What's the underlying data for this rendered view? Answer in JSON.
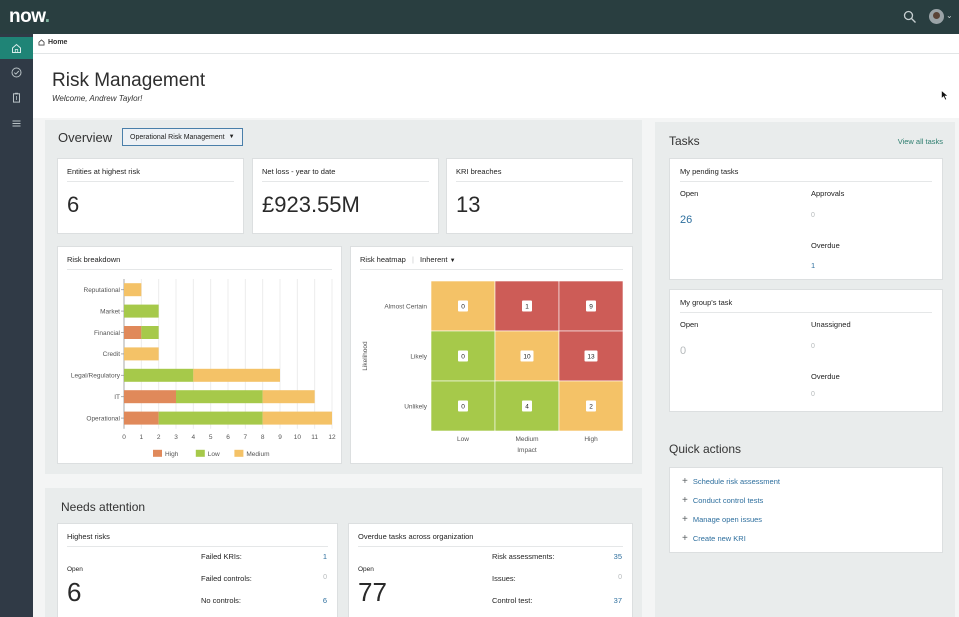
{
  "app": {
    "logo": "now",
    "logo_dot": "."
  },
  "breadcrumb": {
    "label": "Home"
  },
  "header": {
    "title": "Risk Management",
    "welcome": "Welcome, Andrew Taylor!"
  },
  "overview": {
    "title": "Overview",
    "selector": "Operational Risk Management",
    "metrics": [
      {
        "label": "Entities at highest risk",
        "value": "6"
      },
      {
        "label": "Net loss - year to date",
        "value": "£923.55M"
      },
      {
        "label": "KRI breaches",
        "value": "13"
      }
    ],
    "risk_breakdown_title": "Risk breakdown",
    "heatmap_title": "Risk heatmap",
    "heatmap_mode": "Inherent"
  },
  "chart_data": [
    {
      "type": "bar",
      "orientation": "horizontal",
      "stacked": true,
      "title": "Risk breakdown",
      "categories": [
        "Reputational",
        "Market",
        "Financial",
        "Credit",
        "Legal/Regulatory",
        "IT",
        "Operational"
      ],
      "series": [
        {
          "name": "High",
          "color": "#e0895a",
          "values": [
            0,
            0,
            1,
            0,
            0,
            3,
            2
          ]
        },
        {
          "name": "Low",
          "color": "#a6c94a",
          "values": [
            0,
            2,
            1,
            0,
            4,
            5,
            6
          ]
        },
        {
          "name": "Medium",
          "color": "#f4c267",
          "values": [
            1,
            0,
            0,
            2,
            5,
            3,
            4
          ]
        }
      ],
      "x_ticks": [
        "0",
        "1",
        "2",
        "3",
        "4",
        "5",
        "6",
        "7",
        "8",
        "9",
        "10",
        "11",
        "12"
      ],
      "xlim": [
        0,
        12
      ],
      "grid": true,
      "legend": "bottom"
    },
    {
      "type": "heatmap",
      "title": "Risk heatmap",
      "ylabel": "Likelihood",
      "xlabel": "Impact",
      "rows": [
        "Almost Certain",
        "Likely",
        "Unlikely"
      ],
      "cols": [
        "Low",
        "Medium",
        "High"
      ],
      "values": [
        [
          0,
          1,
          9
        ],
        [
          0,
          10,
          13
        ],
        [
          0,
          4,
          2
        ]
      ],
      "cell_colors": [
        [
          "#f4c267",
          "#cd5c57",
          "#cd5c57"
        ],
        [
          "#a6c94a",
          "#f4c267",
          "#cd5c57"
        ],
        [
          "#a6c94a",
          "#a6c94a",
          "#f4c267"
        ]
      ]
    }
  ],
  "tasks": {
    "title": "Tasks",
    "view_all": "View all tasks",
    "pending": {
      "title": "My pending tasks",
      "open_label": "Open",
      "open_value": "26",
      "approvals_label": "Approvals",
      "approvals_value": "0",
      "overdue_label": "Overdue",
      "overdue_value": "1"
    },
    "group": {
      "title": "My group's task",
      "open_label": "Open",
      "open_value": "0",
      "unassigned_label": "Unassigned",
      "unassigned_value": "0",
      "overdue_label": "Overdue",
      "overdue_value": "0"
    }
  },
  "quick_actions": {
    "title": "Quick actions",
    "items": [
      "Schedule risk assessment",
      "Conduct control tests",
      "Manage open issues",
      "Create new KRI"
    ]
  },
  "needs_attention": {
    "title": "Needs attention",
    "highest": {
      "title": "Highest risks",
      "open_label": "Open",
      "open_value": "6",
      "rows": [
        {
          "label": "Failed KRIs:",
          "value": "1"
        },
        {
          "label": "Failed controls:",
          "value": "0"
        },
        {
          "label": "No controls:",
          "value": "6"
        }
      ]
    },
    "overdue": {
      "title": "Overdue tasks across organization",
      "open_label": "Open",
      "open_value": "77",
      "rows": [
        {
          "label": "Risk assessments:",
          "value": "35"
        },
        {
          "label": "Issues:",
          "value": "0"
        },
        {
          "label": "Control test:",
          "value": "37"
        }
      ]
    }
  },
  "colors": {
    "topbar": "#293e40",
    "leftnav": "#303a46",
    "accent": "#1f8476",
    "link": "#2e6f9e"
  }
}
